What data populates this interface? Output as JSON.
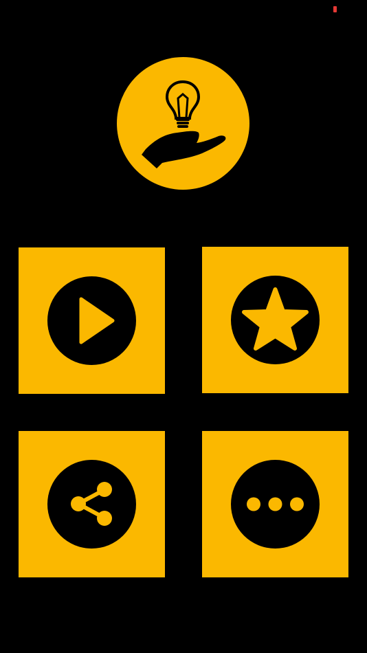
{
  "theme": {
    "background": "#000000",
    "accent": "#fbb800",
    "icon_fill": "#000000",
    "status_indicator": "#e53935"
  },
  "logo": {
    "icon": "hand-lightbulb-icon"
  },
  "menu": {
    "tiles": [
      {
        "action": "play",
        "icon": "play-icon"
      },
      {
        "action": "rate",
        "icon": "star-icon"
      },
      {
        "action": "share",
        "icon": "share-icon"
      },
      {
        "action": "more",
        "icon": "more-dots-icon"
      }
    ]
  }
}
